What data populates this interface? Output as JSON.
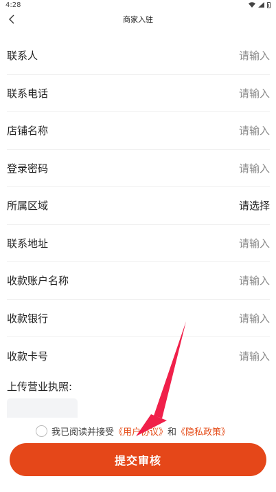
{
  "status_bar": {
    "time": "4:28"
  },
  "nav": {
    "title": "商家入驻"
  },
  "form": {
    "rows": [
      {
        "label": "联系人",
        "placeholder": "请输入"
      },
      {
        "label": "联系电话",
        "placeholder": "请输入"
      },
      {
        "label": "店铺名称",
        "placeholder": "请输入"
      },
      {
        "label": "登录密码",
        "placeholder": "请输入"
      },
      {
        "label": "所属区域",
        "placeholder": "请选择"
      },
      {
        "label": "联系地址",
        "placeholder": "请输入"
      },
      {
        "label": "收款账户名称",
        "placeholder": "请输入"
      },
      {
        "label": "收款银行",
        "placeholder": "请输入"
      },
      {
        "label": "收款卡号",
        "placeholder": "请输入"
      }
    ]
  },
  "upload": {
    "label": "上传营业执照:"
  },
  "agreement": {
    "prefix": "我已阅读并接受",
    "user_agreement": "《用户协议》",
    "and": "和",
    "privacy_policy": "《隐私政策》"
  },
  "submit": {
    "label": "提交审核"
  },
  "colors": {
    "accent": "#e54719",
    "annotation_arrow": "#f0204a"
  }
}
